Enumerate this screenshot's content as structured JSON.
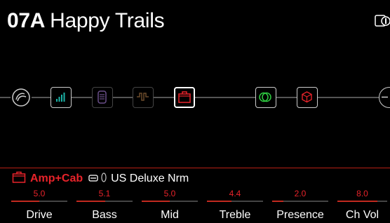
{
  "preset": {
    "number": "07A",
    "name": "Happy Trails"
  },
  "top_right_icon": "snapshot-icon",
  "chain": {
    "blocks": [
      {
        "name": "input-icon",
        "state": "active"
      },
      {
        "name": "dynamics-block",
        "icon": "compressor-icon",
        "color": "#1bb3a7",
        "state": "active"
      },
      {
        "name": "eq-block",
        "icon": "eq-icon",
        "color": "#6a4f8a",
        "state": "bypassed"
      },
      {
        "name": "filter-block",
        "icon": "filter-icon",
        "color": "#6b4a2a",
        "state": "bypassed"
      },
      {
        "name": "amp-block",
        "icon": "amp-icon",
        "color": "#e8232a",
        "state": "selected"
      },
      {
        "name": "modulation-block",
        "icon": "modulation-icon",
        "color": "#2ecc40",
        "state": "active"
      },
      {
        "name": "cab-block",
        "icon": "cab-icon",
        "color": "#e8232a",
        "state": "active"
      },
      {
        "name": "output-icon",
        "state": "active"
      }
    ]
  },
  "block": {
    "category": "Amp+Cab",
    "model": "US Deluxe Nrm",
    "icons": [
      "amp-icon",
      "link-icon",
      "cab-toggle-icon"
    ],
    "accent": "#e8232a"
  },
  "params": [
    {
      "label": "Drive",
      "value": "5.0",
      "level": 0.5
    },
    {
      "label": "Bass",
      "value": "5.1",
      "level": 0.51
    },
    {
      "label": "Mid",
      "value": "5.0",
      "level": 0.5
    },
    {
      "label": "Treble",
      "value": "4.4",
      "level": 0.44
    },
    {
      "label": "Presence",
      "value": "2.0",
      "level": 0.2
    },
    {
      "label": "Ch Vol",
      "value": "8.0",
      "level": 0.8
    }
  ]
}
